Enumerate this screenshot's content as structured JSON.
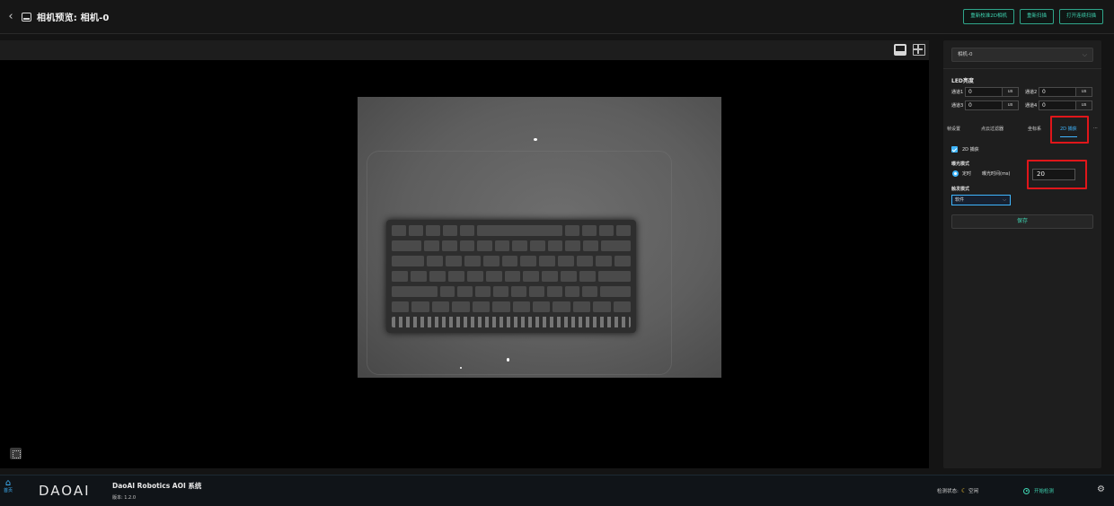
{
  "header": {
    "back_glyph": "‹",
    "title": "相机预览: 相机-0",
    "buttons": [
      "重新校准2D相机",
      "重新扫描",
      "打开连续扫描"
    ]
  },
  "preview": {
    "view_icons": [
      "single-view-icon",
      "grid-view-icon"
    ],
    "fit_icon": "fit-screen-icon"
  },
  "panel": {
    "camera_select": "相机-0",
    "led_title": "LED亮度",
    "channels": [
      {
        "label": "通道1",
        "value": "0",
        "unit": "us"
      },
      {
        "label": "通道2",
        "value": "0",
        "unit": "us"
      },
      {
        "label": "通道3",
        "value": "0",
        "unit": "us"
      },
      {
        "label": "通道4",
        "value": "0",
        "unit": "us"
      }
    ],
    "tabs": [
      "帧设置",
      "点云过滤器",
      "坐标系",
      "2D 捕获",
      "···"
    ],
    "active_tab": "2D 捕获",
    "capture_checkbox": "2D 捕获",
    "exposure_mode_label": "曝光模式",
    "exposure_mode_value": "定时",
    "exposure_time_label": "曝光时间(ms)",
    "exposure_time_value": "20",
    "trigger_mode_label": "触发模式",
    "trigger_mode_value": "软件",
    "save_label": "保存",
    "highlight_color": "#e0161a",
    "accent_color": "#3fb6ff"
  },
  "footer": {
    "home_label": "首页",
    "logo_text": "DAOAI",
    "app_title": "DaoAI Robotics AOI 系统",
    "version": "版本: 1.2.0",
    "status_label": "检测状态:",
    "status_value": "空闲",
    "start_label": "开始检测"
  }
}
